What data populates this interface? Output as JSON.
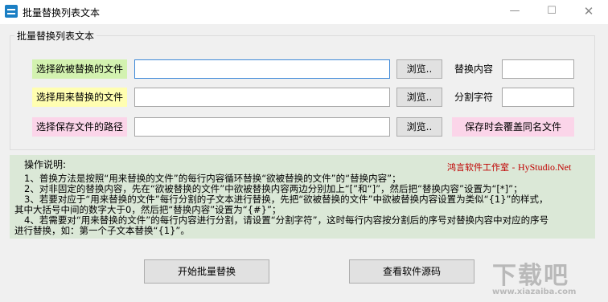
{
  "window": {
    "title": "批量替换列表文本",
    "minimize_icon": "minimize-icon",
    "maximize_icon": "maximize-icon",
    "close_icon": "close-icon"
  },
  "group": {
    "legend": "批量替换列表文本"
  },
  "rows": [
    {
      "label": "选择欲被替换的文件",
      "browse": "浏览..",
      "side_label": "替换内容",
      "color": "#d3f2b0"
    },
    {
      "label": "选择用来替换的文件",
      "browse": "浏览..",
      "side_label": "分割字符",
      "color": "#fffeb1"
    },
    {
      "label": "选择保存文件的路径",
      "browse": "浏览..",
      "option": "保存时会覆盖同名文件",
      "color": "#fbd5e9"
    }
  ],
  "instructions": {
    "title": "操作说明:",
    "brand": "鸿言软件工作室 - ",
    "brand_en": "HyStudio.Net",
    "lines": [
      "1、普换方法是按照“用来替换的文件”的每行内容循环替换“欲被替换的文件”的“替换内容”；",
      "2、对非固定的替换内容，先在“欲被替换的文件”中欲被替换内容两边分别加上“[”和“]”，然后把“替换内容”设置为“[*]”；",
      "3、若要对应于“用来替换的文件”每行分割的子文本进行替换，先把“欲被替换的文件”中欲被替换内容设置为类似“{1}”的样式，",
      "其中大括号中间的数字大于0，然后把“替换内容”设置为“{#}”；",
      "4、若需要对“用来替换的文件”的每行内容进行分割，请设置“分割字符”，这时每行内容按分割后的序号对替换内容中对应的序号",
      "进行替换，如：第一个子文本替换“{1}”。"
    ],
    "bg_color": "#dbe8d7",
    "brand_color": "#c00000"
  },
  "buttons": {
    "start": "开始批量替换",
    "source": "查看软件源码"
  },
  "watermark": {
    "main": "下载吧",
    "sub": "www.xiazaiba.com"
  }
}
